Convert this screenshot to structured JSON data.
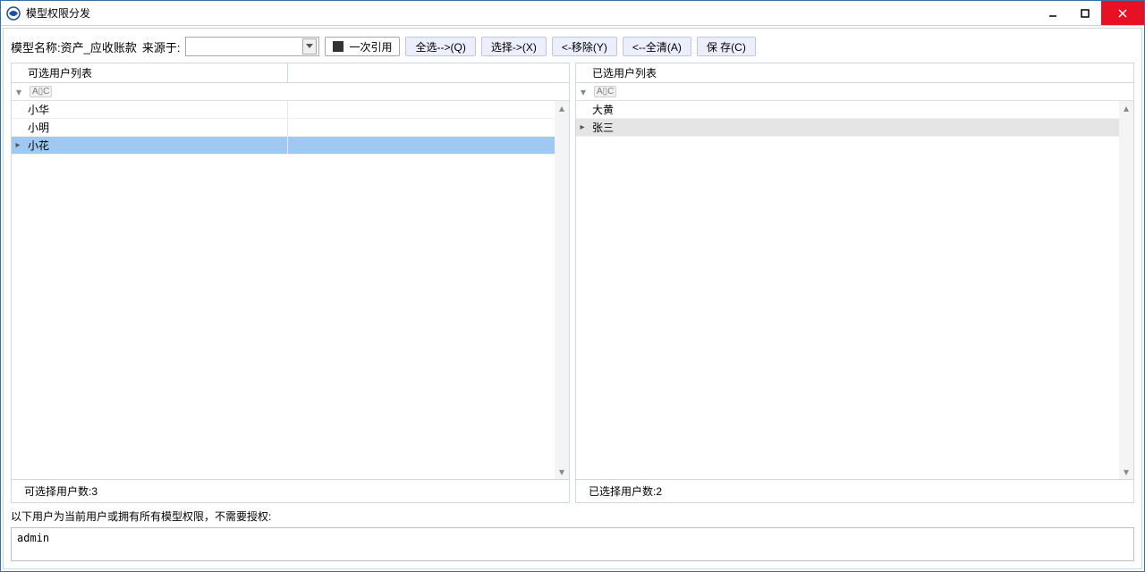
{
  "window": {
    "title": "模型权限分发"
  },
  "toolbar": {
    "model_name_label": "模型名称:资产_应收账款",
    "source_label": "来源于:",
    "once_ref": "一次引用",
    "select_all": "全选-->(Q)",
    "select": "选择->(X)",
    "remove": "<-移除(Y)",
    "clear_all": "<--全清(A)",
    "save": "保 存(C)"
  },
  "left": {
    "header": "可选用户列表",
    "rows": [
      "小华",
      "小明",
      "小花"
    ],
    "selected_index": 2,
    "footer": "可选择用户数:3"
  },
  "right": {
    "header": "已选用户列表",
    "rows": [
      "大黄",
      "张三"
    ],
    "current_index": 1,
    "footer": "已选择用户数:2"
  },
  "bottom": {
    "note": "以下用户为当前用户或拥有所有模型权限，不需要授权:",
    "content": "admin"
  }
}
